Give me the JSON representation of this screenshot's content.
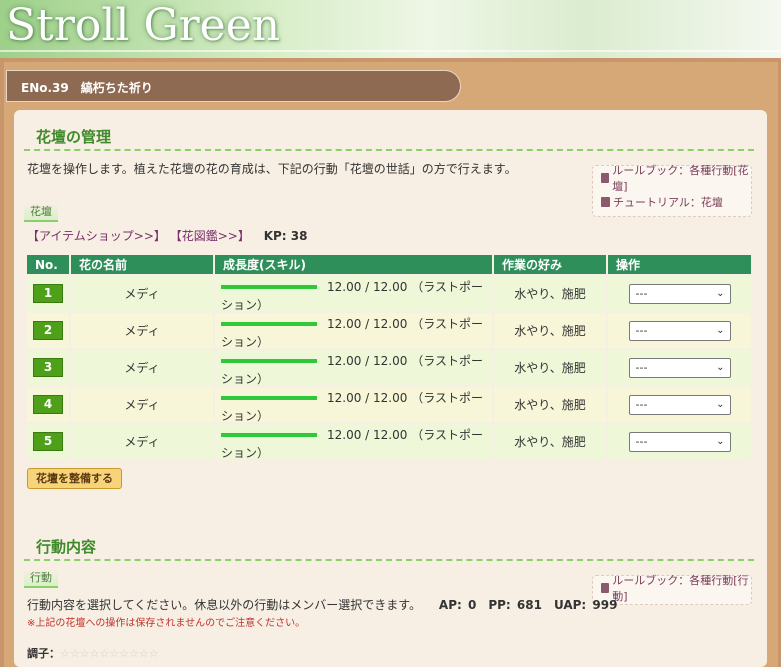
{
  "banner": {
    "title": "Stroll Green"
  },
  "header": {
    "text": "ENo.39　縞朽ちた祈り"
  },
  "flowerbed_section": {
    "title": "花壇の管理",
    "description": "花壇を操作します。植えた花壇の花の育成は、下記の行動「花壇の世話」の方で行えます。",
    "subtab": "花壇",
    "item_shop_link": "【アイテムショップ>>】",
    "encyclopedia_link": "【花図鑑>>】",
    "kp": "KP: 38",
    "rulebook_link": "ルールブック：各種行動[花壇]",
    "tutorial_link": "チュートリアル：花壇",
    "columns": [
      "No.",
      "花の名前",
      "成長度(スキル)",
      "作業の好み",
      "操作"
    ],
    "rows": [
      {
        "no": "1",
        "name": "メディ",
        "growth": "12.00 / 12.00 （ラストポーション）",
        "growth_level": 1.0,
        "preference": "水やり、施肥",
        "operation": "---"
      },
      {
        "no": "2",
        "name": "メディ",
        "growth": "12.00 / 12.00 （ラストポーション）",
        "growth_level": 1.0,
        "preference": "水やり、施肥",
        "operation": "---"
      },
      {
        "no": "3",
        "name": "メディ",
        "growth": "12.00 / 12.00 （ラストポーション）",
        "growth_level": 1.0,
        "preference": "水やり、施肥",
        "operation": "---"
      },
      {
        "no": "4",
        "name": "メディ",
        "growth": "12.00 / 12.00 （ラストポーション）",
        "growth_level": 1.0,
        "preference": "水やり、施肥",
        "operation": "---"
      },
      {
        "no": "5",
        "name": "メディ",
        "growth": "12.00 / 12.00 （ラストポーション）",
        "growth_level": 1.0,
        "preference": "水やり、施肥",
        "operation": "---"
      }
    ],
    "maintain_button": "花壇を整備する"
  },
  "action_section": {
    "title": "行動内容",
    "subtab": "行動",
    "description": "行動内容を選択してください。休息以外の行動はメンバー選択できます。",
    "stats": "AP: 0　PP: 681　UAP: 999",
    "note": "※上記の花壇への操作は保存されませんのでご注意ください。",
    "rulebook_link": "ルールブック：各種行動[行動]",
    "mood_label": "調子：",
    "mood_stars": "☆☆☆☆☆☆☆☆☆☆"
  },
  "colors": {
    "table_header": "#2f8f5a",
    "section_title": "#3f8a2a",
    "growth_bar": "#2fc83a",
    "badge": "#4fa019",
    "button": "#f7d37a"
  },
  "icons": [
    "book-icon",
    "chevron-down-icon"
  ]
}
